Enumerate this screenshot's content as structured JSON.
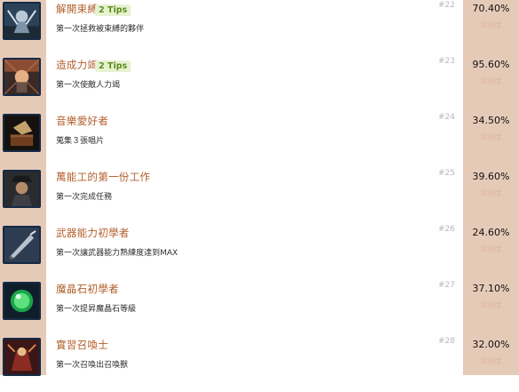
{
  "achievements": [
    {
      "title": "解開束縛",
      "tips": "2 Tips",
      "desc": "第一次拯救被束縛的夥伴",
      "num": "#22",
      "pct": "70.40%",
      "sub": "珍稀度",
      "icon": "rescue-icon"
    },
    {
      "title": "造成力竭",
      "tips": "2 Tips",
      "desc": "第一次使敵人力竭",
      "num": "#23",
      "pct": "95.60%",
      "sub": "珍稀度",
      "icon": "stagger-icon"
    },
    {
      "title": "音樂愛好者",
      "tips": "",
      "desc": "蒐集３張唱片",
      "num": "#24",
      "pct": "34.50%",
      "sub": "珍稀度",
      "icon": "gramophone-icon"
    },
    {
      "title": "萬能工的第一份工作",
      "tips": "",
      "desc": "第一次完成任務",
      "num": "#25",
      "pct": "39.60%",
      "sub": "珍稀度",
      "icon": "mercenary-icon"
    },
    {
      "title": "武器能力初學者",
      "tips": "",
      "desc": "第一次讓武器能力熟練度達到MAX",
      "num": "#26",
      "pct": "24.60%",
      "sub": "珍稀度",
      "icon": "sword-icon"
    },
    {
      "title": "魔晶石初學者",
      "tips": "",
      "desc": "第一次提昇魔晶石等級",
      "num": "#27",
      "pct": "37.10%",
      "sub": "珍稀度",
      "icon": "materia-icon"
    },
    {
      "title": "實習召喚士",
      "tips": "",
      "desc": "第一次召喚出召喚獸",
      "num": "#28",
      "pct": "32.00%",
      "sub": "珍稀度",
      "icon": "summon-icon"
    }
  ]
}
